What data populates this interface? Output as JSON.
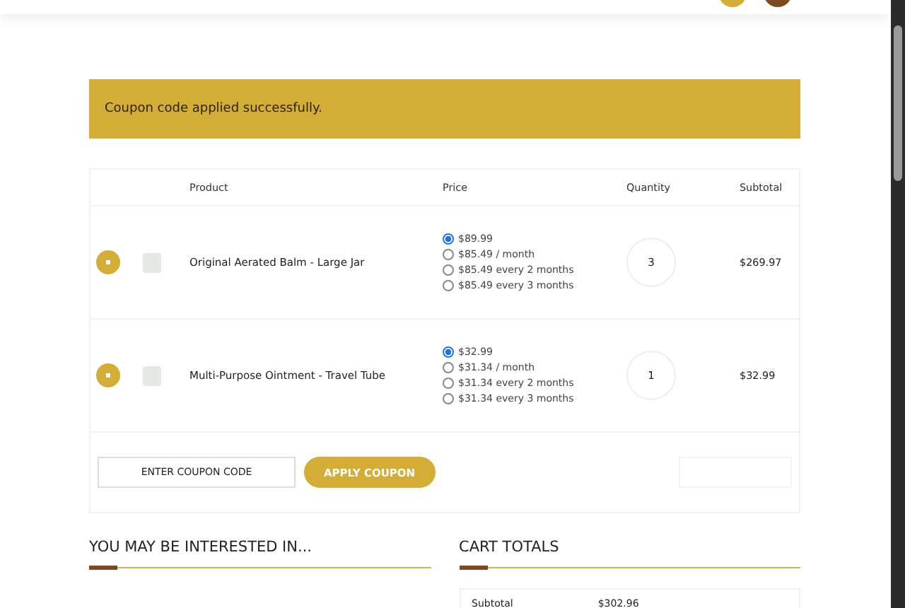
{
  "notice": "Coupon code applied successfully.",
  "table": {
    "columns": [
      "Product",
      "Price",
      "Quantity",
      "Subtotal"
    ],
    "rows": [
      {
        "product": "Original Aerated Balm - Large Jar",
        "options": [
          {
            "label": "$89.99",
            "selected": true
          },
          {
            "label": "$85.49 / month",
            "selected": false
          },
          {
            "label": "$85.49 every 2 months",
            "selected": false
          },
          {
            "label": "$85.49 every 3 months",
            "selected": false
          }
        ],
        "quantity": "3",
        "subtotal": "$269.97"
      },
      {
        "product": "Multi-Purpose Ointment - Travel Tube",
        "options": [
          {
            "label": "$32.99",
            "selected": true
          },
          {
            "label": "$31.34 / month",
            "selected": false
          },
          {
            "label": "$31.34 every 2 months",
            "selected": false
          },
          {
            "label": "$31.34 every 3 months",
            "selected": false
          }
        ],
        "quantity": "1",
        "subtotal": "$32.99"
      }
    ]
  },
  "coupon": {
    "placeholder": "ENTER COUPON CODE",
    "button": "APPLY COUPON"
  },
  "related": {
    "title": "YOU MAY BE INTERESTED IN..."
  },
  "totals": {
    "title": "CART TOTALS",
    "rows": [
      {
        "label": "Subtotal",
        "value": "$302.96"
      }
    ]
  }
}
